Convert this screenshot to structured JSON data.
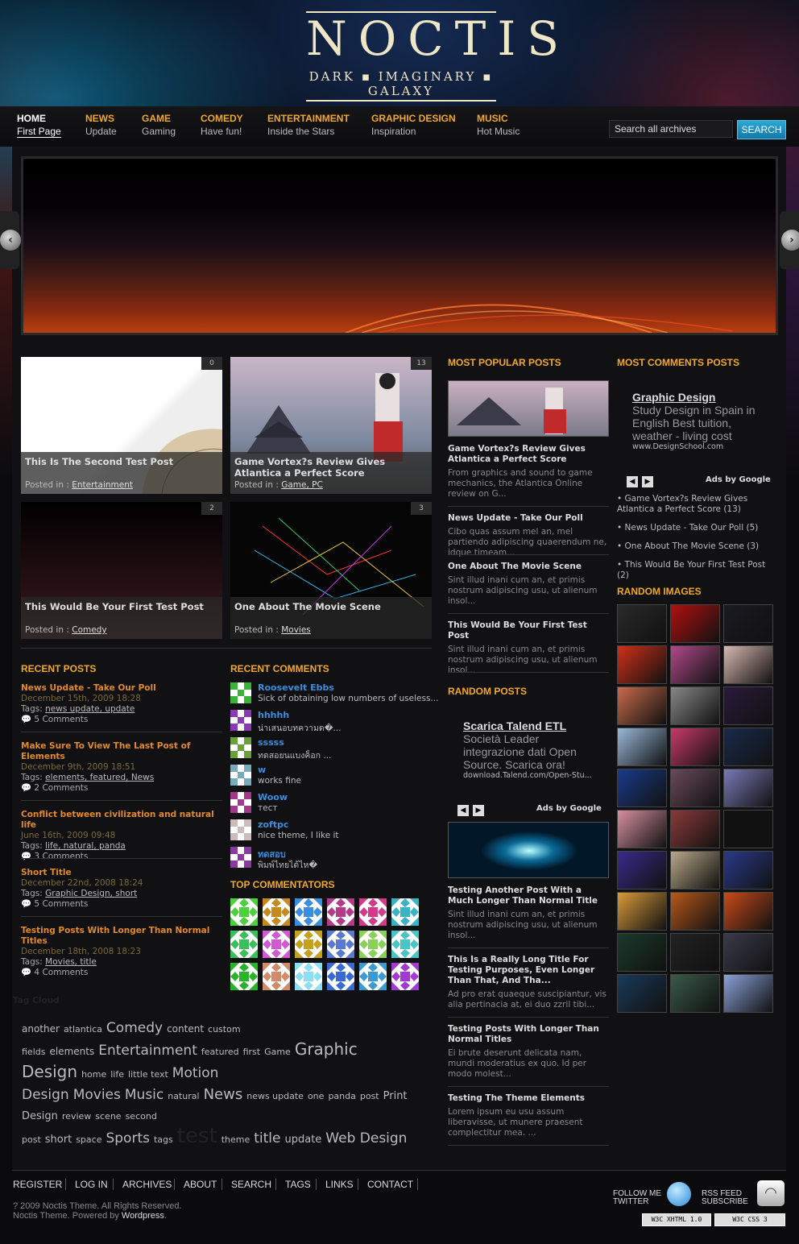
{
  "brand": {
    "title": "NOCTIS",
    "subtitle": "DARK ▪ IMAGINARY ▪ GALAXY"
  },
  "nav": [
    {
      "title": "HOME",
      "sub": "First Page"
    },
    {
      "title": "NEWS",
      "sub": "Update"
    },
    {
      "title": "GAME",
      "sub": "Gaming"
    },
    {
      "title": "COMEDY",
      "sub": "Have fun!"
    },
    {
      "title": "ENTERTAINMENT",
      "sub": "Inside the Stars"
    },
    {
      "title": "GRAPHIC DESIGN",
      "sub": "Inspiration"
    },
    {
      "title": "MUSIC",
      "sub": "Hot Music"
    }
  ],
  "search": {
    "value": "Search all archives",
    "button": "SEARCH"
  },
  "colors": {
    "accent": "#f1a82a",
    "link": "#e2892a",
    "commenter": "#3a8ee0"
  },
  "featured": [
    {
      "title": "This Is The Second Test Post",
      "label": "Posted in :",
      "cat": "Entertainment",
      "count": "0"
    },
    {
      "title": "Game Vortex?s Review Gives Atlantica a Perfect Score",
      "label": "Posted in :",
      "cat": "Game, PC",
      "count": "13"
    },
    {
      "title": "This Would Be Your First Test Post",
      "label": "Posted in :",
      "cat": "Comedy",
      "count": "2"
    },
    {
      "title": "One About The Movie Scene",
      "label": "Posted in :",
      "cat": "Movies",
      "count": "3"
    }
  ],
  "recent_posts": {
    "heading": "RECENT POSTS",
    "items": [
      {
        "title": "News Update - Take Our Poll",
        "date": "December 15th, 2009 18:28",
        "tags_label": "Tags:",
        "tags": "news update, update",
        "comments": "5 Comments"
      },
      {
        "title": "Make Sure To View The Last Post of Elements",
        "date": "December 9th, 2009 18:51",
        "tags_label": "Tags:",
        "tags": "elements, featured, News",
        "comments": "2 Comments"
      },
      {
        "title": "Conflict between civilization and natural life",
        "date": "June 16th, 2009 09:48",
        "tags_label": "Tags:",
        "tags": "life, natural, panda",
        "comments": "3 Comments"
      },
      {
        "title": "Short Title",
        "date": "December 22nd, 2008 18:24",
        "tags_label": "Tags:",
        "tags": "Graphic Design, short",
        "comments": "5 Comments"
      },
      {
        "title": "Testing Posts With Longer Than Normal Titles",
        "date": "December 18th, 2008 18:23",
        "tags_label": "Tags:",
        "tags": "Movies, title",
        "comments": "4 Comments"
      }
    ]
  },
  "recent_comments": {
    "heading": "RECENT COMMENTS",
    "items": [
      {
        "name": "Roosevelt Ebbs",
        "text": "Sick of obtaining low numbers of useless...",
        "color": "#3bb33b"
      },
      {
        "name": "hhhhh",
        "text": "น่าเสนอบทความด�...",
        "color": "#8a3bb3"
      },
      {
        "name": "sssss",
        "text": "ทดสอยนแบงค็อก ...",
        "color": "#6aa03a"
      },
      {
        "name": "w",
        "text": "works fine",
        "color": "#7ab"
      },
      {
        "name": "Woow",
        "text": "тест",
        "color": "#a03a8a"
      },
      {
        "name": "zoftpc",
        "text": "nice theme, I like it",
        "color": "#cbb"
      },
      {
        "name": "ทดสอบ",
        "text": "พิมพ์ไทยได้ไห�",
        "color": "#8a3ba0"
      }
    ]
  },
  "top_commentators": {
    "heading": "TOP COMMENTATORS",
    "colors": [
      "#4bd13b",
      "#c48a1e",
      "#3a8ee0",
      "#b33b8a",
      "#d13b8a",
      "#3ab3c4",
      "#3bbf5a",
      "#d15ad1",
      "#c4a01e",
      "#5a7ad1",
      "#8ad15a",
      "#4ac4c4",
      "#2ab32a",
      "#d18a6a",
      "#8ae0f0",
      "#3a6ad1",
      "#3a9ad1",
      "#a03ad1"
    ]
  },
  "tag_cloud": {
    "heading": "Tag Cloud",
    "tags": [
      {
        "t": "another",
        "s": 12
      },
      {
        "t": "atlantica",
        "s": 11
      },
      {
        "t": "Comedy",
        "s": 17
      },
      {
        "t": "content",
        "s": 12
      },
      {
        "t": "custom fields",
        "s": 11
      },
      {
        "t": "elements",
        "s": 12
      },
      {
        "t": "Entertainment",
        "s": 17
      },
      {
        "t": "featured",
        "s": 11
      },
      {
        "t": "first",
        "s": 11
      },
      {
        "t": "Game",
        "s": 11
      },
      {
        "t": "Graphic Design",
        "s": 20
      },
      {
        "t": "home",
        "s": 11
      },
      {
        "t": "life",
        "s": 11
      },
      {
        "t": "little text",
        "s": 11
      },
      {
        "t": "Motion Design",
        "s": 17
      },
      {
        "t": "Movies",
        "s": 17
      },
      {
        "t": "Music",
        "s": 17
      },
      {
        "t": "natural",
        "s": 11
      },
      {
        "t": "News",
        "s": 18
      },
      {
        "t": "news update",
        "s": 11
      },
      {
        "t": "one",
        "s": 11
      },
      {
        "t": "panda",
        "s": 11
      },
      {
        "t": "post",
        "s": 11
      },
      {
        "t": "Print Design",
        "s": 13
      },
      {
        "t": "review",
        "s": 11
      },
      {
        "t": "scene",
        "s": 11
      },
      {
        "t": "second post",
        "s": 11
      },
      {
        "t": "short",
        "s": 13
      },
      {
        "t": "space",
        "s": 11
      },
      {
        "t": "Sports",
        "s": 17
      },
      {
        "t": "tags",
        "s": 11
      },
      {
        "t": "test",
        "s": 26
      },
      {
        "t": "theme",
        "s": 11
      },
      {
        "t": "title",
        "s": 17
      },
      {
        "t": "update",
        "s": 13
      },
      {
        "t": "Web Design",
        "s": 17
      }
    ]
  },
  "popular": {
    "heading": "MOST POPULAR POSTS",
    "items": [
      {
        "title": "Game Vortex?s Review Gives Atlantica a Perfect Score",
        "text": "From graphics and sound to game mechanics, the Atlantica Online review on G..."
      },
      {
        "title": "News Update - Take Our Poll",
        "text": "Cibo quas assum mel an, mel partiendo adipiscing quaerendum ne, idque timeam..."
      },
      {
        "title": "One About The Movie Scene",
        "text": "Sint illud inani cum an, et primis nostrum adipiscing usu, ut alienum insol..."
      },
      {
        "title": "This Would Be Your First Test Post",
        "text": "Sint illud inani cum an, et primis nostrum adipiscing usu, ut alienum insol..."
      }
    ]
  },
  "ads": [
    {
      "title": "Scarica Talend ETL",
      "body": "Società Leader integrazione dati Open Source. Scarica ora!",
      "url": "download.Talend.com/Open-Stu...",
      "by": "Ads by Google"
    },
    {
      "title": "Graphic Design",
      "body": "Study Design in Spain in English Best tuition, weather - living cost",
      "url": "www.DesignSchool.com",
      "by": "Ads by Google"
    }
  ],
  "random_posts": {
    "heading": "RANDOM POSTS",
    "items": [
      {
        "title": "Testing Another Post With a Much Longer Than Normal Title",
        "text": "Sint illud inani cum an, et primis nostrum adipiscing usu, ut alienum insol..."
      },
      {
        "title": "This Is a Really Long Title For Testing Purposes, Even Longer Than That, And Tha...",
        "text": "Ad pro erat quaeque suscipiantur, vis alia pertinacia at, ei duo zzril tibi..."
      },
      {
        "title": "Testing Posts With Longer Than Normal Titles",
        "text": "Ei brute deserunt delicata nam, mundi moderatius ex quo. Id per modo molest..."
      },
      {
        "title": "Testing The Theme Elements",
        "text": "Lorem ipsum eu usu assum liberavisse, ut munere praesent complectitur mea. ..."
      }
    ]
  },
  "most_comments": {
    "heading": "MOST COMMENTS POSTS",
    "items": [
      "Game Vortex?s Review Gives Atlantica a Perfect Score (13)",
      "News Update - Take Our Poll (5)",
      "One About The Movie Scene (3)",
      "This Would Be Your First Test Post (2)"
    ]
  },
  "random_images": {
    "heading": "RANDOM IMAGES",
    "colors": [
      "#2a2a2a",
      "#b01010",
      "#1a1a22",
      "#d0301a",
      "#b04a8a",
      "#d8b8b0",
      "#c86a4a",
      "#888",
      "#2a1a3a",
      "#9ab8d8",
      "#c83a6a",
      "#1a2a4a",
      "#1a3a8a",
      "#6a4a5a",
      "#7a7ab8",
      "#d890a0",
      "#8a3a3a",
      "#111",
      "#3a2a8a",
      "#b8a888",
      "#2a3a8a",
      "#d89a3a",
      "#b8581a",
      "#c84a1a",
      "#1a3a2a",
      "#222",
      "#3a3a4a",
      "#1a3a5a",
      "#3a5a4a",
      "#8aa0d8"
    ]
  },
  "footer": {
    "links": [
      "REGISTER",
      "LOG IN",
      "ARCHIVES",
      "ABOUT",
      "SEARCH",
      "TAGS",
      "LINKS",
      "CONTACT"
    ],
    "copy1": "? 2009 Noctis Theme. All Rights Reserved.",
    "copy2a": "Noctis Theme. Powered by ",
    "copy2b": "Wordpress",
    "copy2c": ".",
    "follow1": "FOLLOW ME",
    "follow2": "TWITTER",
    "rss1": "RSS FEED",
    "rss2": "SUBSCRIBE",
    "badge1": "W3C XHTML 1.0",
    "badge2": "W3C CSS 3"
  }
}
